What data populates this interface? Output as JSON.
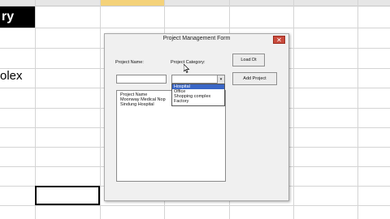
{
  "sheet": {
    "header_cell": "ry",
    "side_text": "olex"
  },
  "dialog": {
    "title": "Project Management Form",
    "close_glyph": "✕",
    "project_name_label": "Project Name:",
    "project_category_label": "Project Category:",
    "load_button": "Load Dt",
    "add_button": "Add Project",
    "dropdown_arrow": "▾",
    "list": [
      "Project Name",
      "Moonway Medical Nop",
      "Sindung Hospital"
    ],
    "category_options": [
      {
        "label": "Hospital",
        "selected": true
      },
      {
        "label": "Office",
        "selected": false
      },
      {
        "label": "Shopping complex",
        "selected": false
      },
      {
        "label": "Factory",
        "selected": false
      }
    ]
  },
  "colors": {
    "close_button": "#c94a3c",
    "selection_highlight": "#3a66c6",
    "column_highlight": "#f4d27a"
  }
}
